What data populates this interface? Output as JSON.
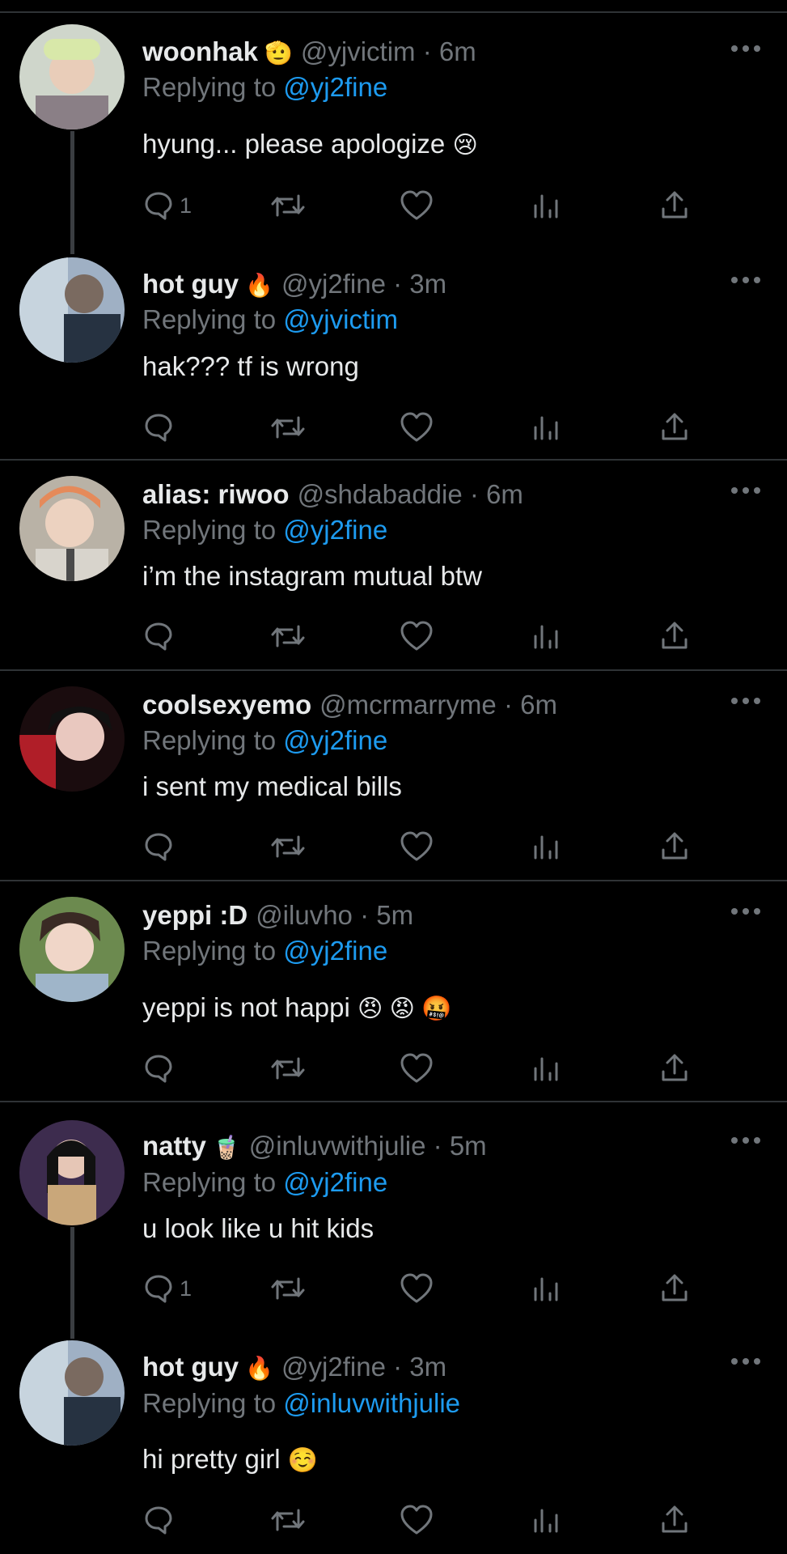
{
  "colors": {
    "background": "#000000",
    "text": "#e7e9ea",
    "muted": "#71767b",
    "link": "#1d9bf0",
    "divider": "#2f3336"
  },
  "replying_label": "Replying to",
  "tweets": [
    {
      "name": "woonhak",
      "badge": "🫡",
      "handle": "@yjvictim",
      "time": "· 6m",
      "replying_to": "@yj2fine",
      "text": "hyung... please apologize",
      "emoji": "😢",
      "reply_count": "1"
    },
    {
      "name": "hot guy",
      "badge": "🔥",
      "handle": "@yj2fine",
      "time": "· 3m",
      "replying_to": "@yjvictim",
      "text": "hak??? tf is wrong",
      "emoji": "",
      "reply_count": ""
    },
    {
      "name": "alias: riwoo",
      "badge": "",
      "handle": "@shdabaddie",
      "time": "· 6m",
      "replying_to": "@yj2fine",
      "text": "i’m the instagram mutual btw",
      "emoji": "",
      "reply_count": ""
    },
    {
      "name": "coolsexyemo",
      "badge": "",
      "handle": "@mcrmarryme",
      "time": "· 6m",
      "replying_to": "@yj2fine",
      "text": "i sent my medical bills",
      "emoji": "",
      "reply_count": ""
    },
    {
      "name": "yeppi :D",
      "badge": "",
      "handle": "@iluvho",
      "time": "· 5m",
      "replying_to": "@yj2fine",
      "text": "yeppi is not happi",
      "emoji": "😠 😡 🤬",
      "reply_count": ""
    },
    {
      "name": "natty",
      "badge": "🧋",
      "handle": "@inluvwithjulie",
      "time": "· 5m",
      "replying_to": "@yj2fine",
      "text": "u look like u hit kids",
      "emoji": "",
      "reply_count": "1"
    },
    {
      "name": "hot guy",
      "badge": "🔥",
      "handle": "@yj2fine",
      "time": "· 3m",
      "replying_to": "@inluvwithjulie",
      "text": "hi pretty girl",
      "emoji": "☺️",
      "reply_count": ""
    }
  ],
  "icons": {
    "reply": "reply-icon",
    "retweet": "retweet-icon",
    "like": "heart-icon",
    "views": "views-icon",
    "share": "share-icon",
    "more": "more-icon"
  }
}
